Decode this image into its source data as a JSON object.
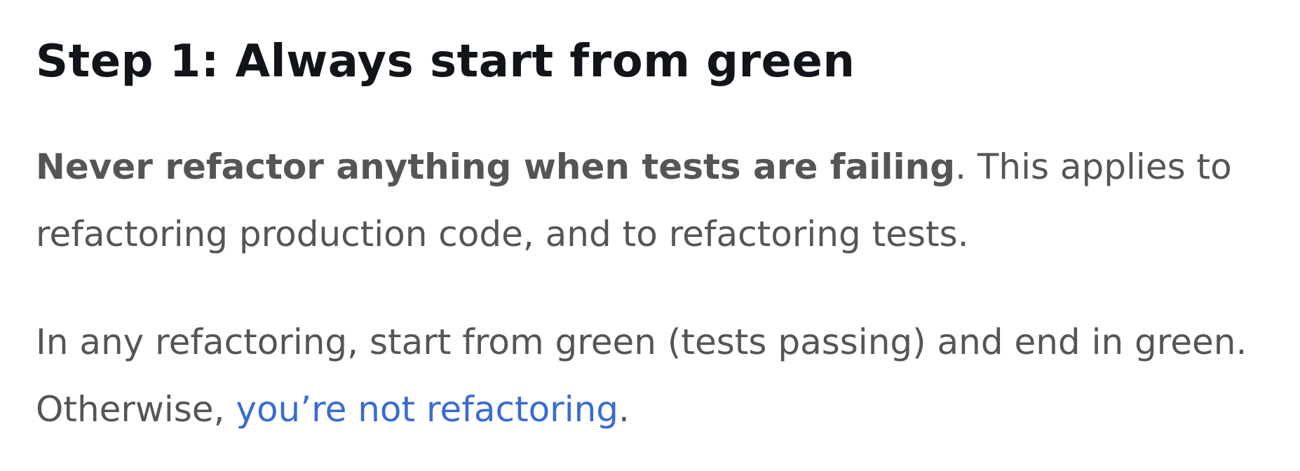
{
  "heading": "Step 1: Always start from green",
  "paragraph1": {
    "bold": "Never refactor anything when tests are failing",
    "rest": ". This applies to refactoring production code, and to refactoring tests."
  },
  "paragraph2": {
    "text": "In any refactoring, start from green (tests passing) and end in green. Otherwise, ",
    "link": "you’re not refactoring",
    "end": "."
  },
  "colors": {
    "heading": "#111418",
    "body_text": "#555555",
    "link": "#3a6ccf"
  }
}
